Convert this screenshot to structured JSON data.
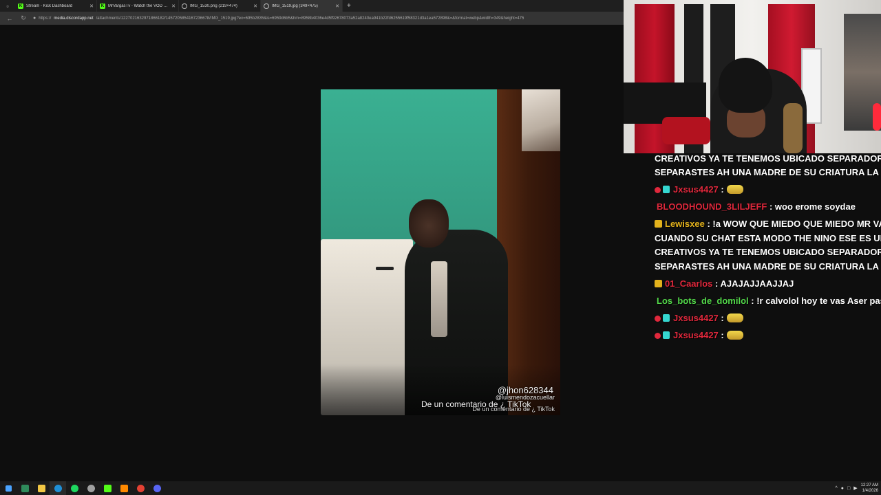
{
  "browser": {
    "tabs": [
      {
        "title": "Stream - Kick Dashboard",
        "icon": "kick-icon",
        "active": false
      },
      {
        "title": "MrVargasTv - Watch the VOD on Kick",
        "icon": "kick-icon",
        "active": false
      },
      {
        "title": "IMG_1530.png (219×474)",
        "icon": "globe-icon",
        "active": false
      },
      {
        "title": "IMG_1519.jpg (349×475)",
        "icon": "globe-icon",
        "active": true
      }
    ],
    "new_tab": "+",
    "url_prefix": "https://",
    "url_host": "media.discordapp.net",
    "url_path": "/attachments/1227021632971866182/1457205854167236678/IMG_1519.jpg?ex=695b2835&is=6959d6b5&hm=8958b4036e4d5f92678073a52a8240ea941b22fd6255619f58321d3a1ea572898&=&format=webp&width=349&height=475"
  },
  "photo": {
    "watermark_user": "@jhon628344",
    "watermark_user2": "@luismendozacuellar",
    "caption": "De un comentario de ¿ TikTok",
    "caption2": "De un comentario de ¿ TikTok"
  },
  "chat": {
    "messages": [
      {
        "user": "",
        "text": "CREATIVOS YA TE TENEMOS UBICADO SEPARADOR D",
        "color": "#ffffff"
      },
      {
        "user": "",
        "text": "SEPARASTES AH UNA MADRE DE SU CRIATURA LA V",
        "color": "#ffffff"
      },
      {
        "user": "Jxsus4427",
        "text": ":",
        "color": "#e0283c",
        "badges": [
          "red",
          "cyan"
        ],
        "emote": true
      },
      {
        "user": "BLOODHOUND_3LILJEFF",
        "text": ": woo erome soydae",
        "color": "#e0283c",
        "badges": []
      },
      {
        "user": "Lewisxee",
        "text": ": !a WOW QUE MIEDO QUE MIEDO MR VA",
        "color": "#e3b21c",
        "badges": [
          "crown"
        ]
      },
      {
        "user": "",
        "text": "CUANDO SU CHAT ESTA MODO THE NINO ESE ES UN",
        "color": "#ffffff"
      },
      {
        "user": "",
        "text": "CREATIVOS YA TE TENEMOS UBICADO SEPARADOR D",
        "color": "#ffffff"
      },
      {
        "user": "",
        "text": "SEPARASTES AH UNA MADRE DE SU CRIATURA LA V",
        "color": "#ffffff"
      },
      {
        "user": "01_Caarlos",
        "text": ": AJAJAJJAAJJAJ",
        "color": "#e0283c",
        "badges": [
          "crown"
        ]
      },
      {
        "user": "Los_bots_de_domilol",
        "text": ": !r calvolol hoy te vas Aser pas",
        "color": "#53d84a",
        "badges": []
      },
      {
        "user": "Jxsus4427",
        "text": ":",
        "color": "#e0283c",
        "badges": [
          "red",
          "cyan"
        ],
        "emote": true
      },
      {
        "user": "Jxsus4427",
        "text": ":",
        "color": "#e0283c",
        "badges": [
          "red",
          "cyan"
        ],
        "emote": true
      }
    ]
  },
  "taskbar": {
    "time": "12:27 AM",
    "date": "1/4/2026"
  }
}
